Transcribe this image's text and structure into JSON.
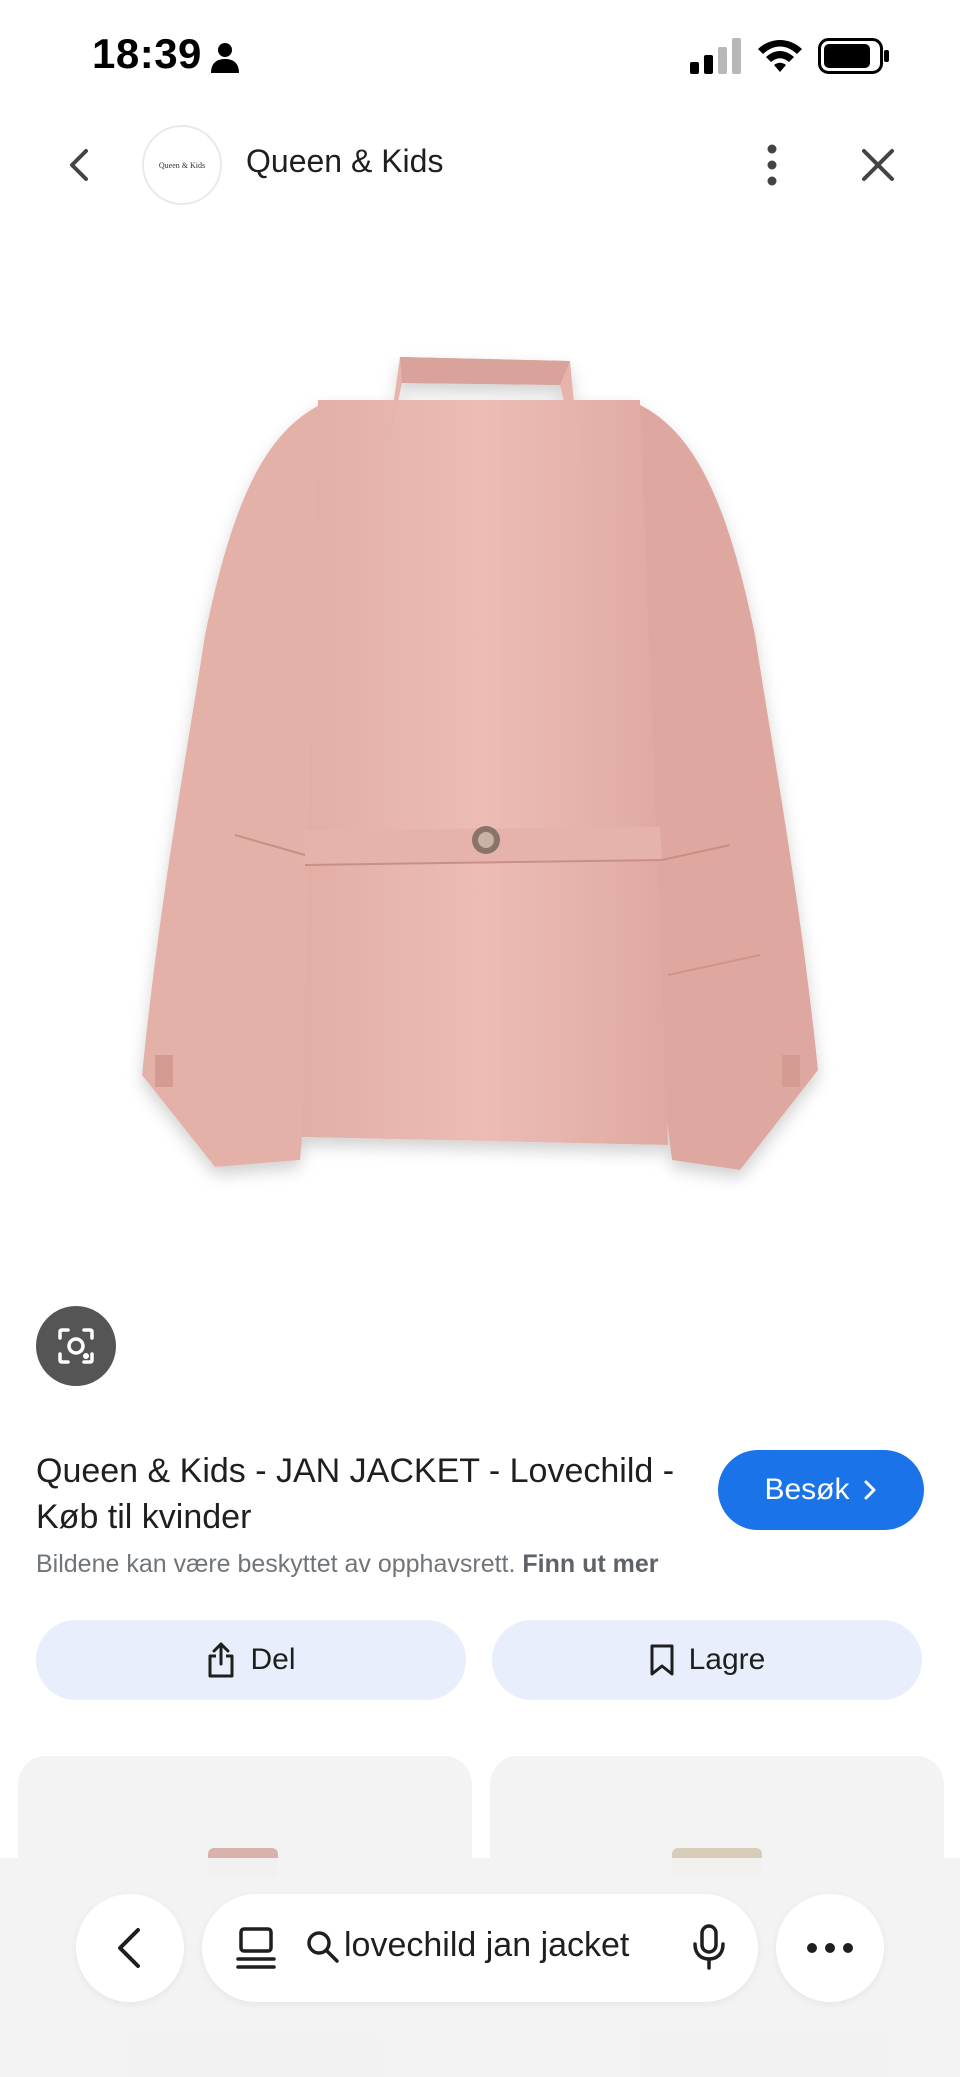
{
  "status_bar": {
    "time": "18:39",
    "icons": [
      "person-icon",
      "cellular-signal-icon",
      "wifi-icon",
      "battery-icon"
    ]
  },
  "header": {
    "site_name": "Queen & Kids",
    "site_logo_text": "Queen & Kids",
    "icons": [
      "chevron-left-icon",
      "kebab-menu-icon",
      "close-icon"
    ]
  },
  "product": {
    "image_subject": "pink jacket, back view",
    "title": "Queen & Kids - JAN JACKET - Lovechild - Køb til kvinder",
    "visit_label": "Besøk",
    "copyright_text": "Bildene kan være beskyttet av opphavsrett.",
    "learn_more_label": "Finn ut mer"
  },
  "actions": {
    "share_label": "Del",
    "save_label": "Lagre"
  },
  "bottom_bar": {
    "search_query": "lovechild jan jacket",
    "icons": [
      "chevron-left-icon",
      "tabs-icon",
      "search-icon",
      "microphone-icon",
      "more-horizontal-icon"
    ]
  },
  "colors": {
    "accent": "#1a73e8",
    "action_button_bg": "#e8eefc",
    "jacket_pink": "#e9b9b1"
  }
}
